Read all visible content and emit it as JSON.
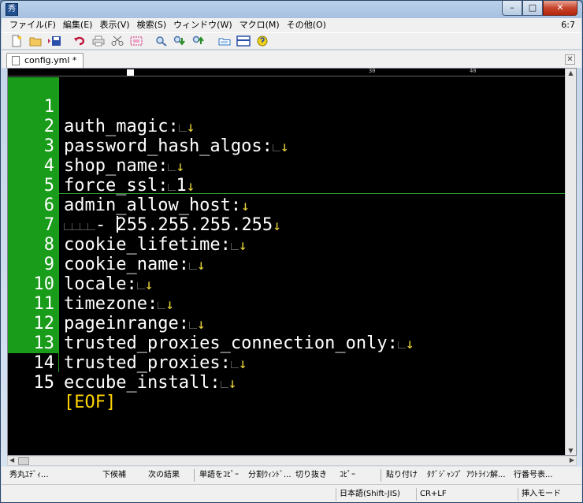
{
  "titlebar": {
    "app_icon": "秀",
    "min_glyph": "–",
    "max_glyph": "□",
    "close_glyph": "✕"
  },
  "menu": {
    "items": [
      "ファイル(F)",
      "編集(E)",
      "表示(V)",
      "検索(S)",
      "ウィンドウ(W)",
      "マクロ(M)",
      "その他(O)"
    ],
    "cursor_position": "6:7"
  },
  "toolbar": {
    "icons": [
      "new-file-icon",
      "open-folder-icon",
      "save-icon",
      "undo-icon",
      "print-icon",
      "cut-icon",
      "copy-icon",
      "find-icon",
      "find-down-icon",
      "find-up-icon",
      "grep-icon",
      "window-icon",
      "help-icon"
    ]
  },
  "tab": {
    "label": "config.yml *",
    "close": "✕"
  },
  "ruler": {
    "marks": [
      "30",
      "40"
    ]
  },
  "editor": {
    "lines": [
      {
        "num": "1",
        "text": "auth_magic:"
      },
      {
        "num": "2",
        "text": "password_hash_algos:"
      },
      {
        "num": "3",
        "text": "shop_name:"
      },
      {
        "num": "4",
        "text": "force_ssl:",
        "value": "1"
      },
      {
        "num": "5",
        "text": "admin_allow_host:"
      },
      {
        "num": "6",
        "prefix": "- ",
        "value": "255.255.255.255"
      },
      {
        "num": "7",
        "text": "cookie_lifetime:"
      },
      {
        "num": "8",
        "text": "cookie_name:"
      },
      {
        "num": "9",
        "text": "locale:"
      },
      {
        "num": "10",
        "text": "timezone:"
      },
      {
        "num": "11",
        "text": "pageinrange:"
      },
      {
        "num": "12",
        "text": "trusted_proxies_connection_only:"
      },
      {
        "num": "13",
        "text": "trusted_proxies:"
      },
      {
        "num": "14",
        "text": "eccube_install:"
      },
      {
        "num": "15",
        "eof": "[EOF]"
      }
    ],
    "return_mark": "↓"
  },
  "function_keys": {
    "items": [
      "秀丸ｴﾃﾞｨ...",
      "下候補",
      "次の結果",
      "|",
      "単語をｺﾋﾟｰ",
      "分割ｳｨﾝﾄﾞ...",
      "切り抜き",
      "ｺﾋﾟｰ",
      "|",
      "貼り付け",
      "ﾀｸﾞｼﾞｬﾝﾌﾟ",
      "ｱｳﾄﾗｲﾝ解...",
      "行番号表..."
    ]
  },
  "status": {
    "encoding": "日本語(Shift-JIS)",
    "newline": "CR+LF",
    "mode": "挿入モード"
  }
}
